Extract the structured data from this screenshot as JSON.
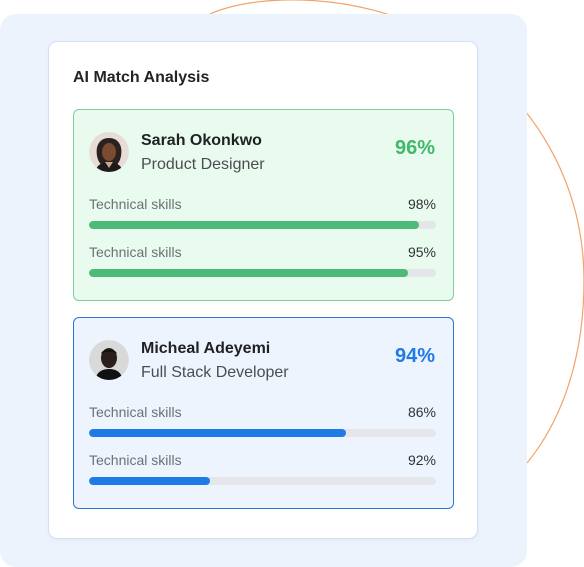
{
  "panel": {
    "title": "AI Match Analysis"
  },
  "candidates": [
    {
      "name": "Sarah Okonkwo",
      "role": "Product Designer",
      "score": "96%",
      "skills": [
        {
          "label": "Technical skills",
          "value_text": "98%",
          "level": 0.95
        },
        {
          "label": "Technical skills",
          "value_text": "95%",
          "level": 0.92
        }
      ]
    },
    {
      "name": "Micheal Adeyemi",
      "role": "Full Stack Developer",
      "score": "94%",
      "skills": [
        {
          "label": "Technical skills",
          "value_text": "86%",
          "level": 0.74
        },
        {
          "label": "Technical skills",
          "value_text": "92%",
          "level": 0.35
        }
      ]
    }
  ],
  "colors": {
    "backdrop": "#edf3fd",
    "accent_orange": "#f2a36c",
    "green_card_bg": "#e9fbee",
    "green_card_border": "#7fcf98",
    "green_accent": "#3fb96b",
    "blue_card_bg": "#eef4fe",
    "blue_card_border": "#2b76cf",
    "blue_accent": "#1f7be6",
    "track": "#e4e6e9"
  }
}
